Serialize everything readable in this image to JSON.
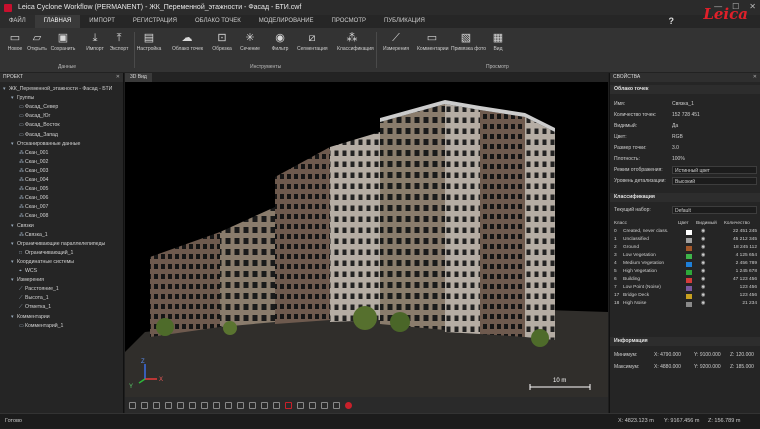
{
  "titlebar": {
    "title": "Leica Cyclone Workflow (PERMANENT) - ЖК_Переменной_этажности - Фасад - БТИ.cwf",
    "minimize": "—",
    "maximize": "☐",
    "close": "✕"
  },
  "menu": {
    "tabs": [
      "ФАЙЛ",
      "ГЛАВНАЯ",
      "ИМПОРТ",
      "РЕГИСТРАЦИЯ",
      "ОБЛАКО ТОЧЕК",
      "МОДЕЛИРОВАНИЕ",
      "ПРОСМОТР",
      "ПУБЛИКАЦИЯ"
    ],
    "help": "?",
    "brand": "Leica"
  },
  "ribbon": {
    "buttons": [
      "Новое",
      "Открыть",
      "Сохранить",
      "Импорт",
      "Экспорт",
      "Настройка",
      "Облако точек",
      "Обрезка",
      "Сечение",
      "Фильтр",
      "Сегментация",
      "Классификация",
      "Измерения",
      "Комментарии",
      "Привязка фото",
      "Вид"
    ],
    "groups": [
      "Данные",
      "Инструменты",
      "Просмотр"
    ]
  },
  "project": {
    "header": "ПРОЕКТ",
    "items": [
      {
        "label": "ЖК_Переменной_этажности - Фасад - БТИ"
      },
      {
        "label": "Группы"
      },
      {
        "label": "Фасад_Север"
      },
      {
        "label": "Фасад_Юг"
      },
      {
        "label": "Фасад_Восток"
      },
      {
        "label": "Фасад_Запад"
      },
      {
        "label": "Отсканированные данные"
      },
      {
        "label": "Скан_001"
      },
      {
        "label": "Скан_002"
      },
      {
        "label": "Скан_003"
      },
      {
        "label": "Скан_004"
      },
      {
        "label": "Скан_005"
      },
      {
        "label": "Скан_006"
      },
      {
        "label": "Скан_007"
      },
      {
        "label": "Скан_008"
      },
      {
        "label": "Связки"
      },
      {
        "label": "Связка_1"
      },
      {
        "label": "Ограничивающие параллелепипеды"
      },
      {
        "label": "Ограничивающий_1"
      },
      {
        "label": "Координатные системы"
      },
      {
        "label": "WCS"
      },
      {
        "label": "Измерения"
      },
      {
        "label": "Расстояние_1"
      },
      {
        "label": "Высота_1"
      },
      {
        "label": "Отметка_1"
      },
      {
        "label": "Комментарии"
      },
      {
        "label": "Комментарий_1"
      }
    ]
  },
  "viewport": {
    "tab": "3D Вид",
    "scale_label": "10 m",
    "axis_x": "X",
    "axis_y": "Y",
    "axis_z": "Z"
  },
  "properties": {
    "header": "СВОЙСТВА",
    "section_point_cloud": "Облако точек",
    "rows": [
      {
        "k": "Имя:",
        "v": "Связка_1"
      },
      {
        "k": "Количество точек:",
        "v": "152 728 451"
      },
      {
        "k": "Видимый:",
        "v": "Да"
      },
      {
        "k": "Цвет:",
        "v": "RGB"
      },
      {
        "k": "Размер точки:",
        "v": "3.0"
      },
      {
        "k": "Плотность:",
        "v": "100%"
      },
      {
        "k": "Режим отображения:",
        "v": "Истинный цвет"
      },
      {
        "k": "Уровень детализации:",
        "v": "Высокий"
      }
    ],
    "section_classification": "Классификация",
    "current_set_label": "Текущий набор:",
    "current_set": "Default",
    "cls_headers": [
      "Класс",
      "Цвет",
      "Видимый",
      "Количество"
    ],
    "classes": [
      {
        "id": "0",
        "name": "Created, never class.",
        "color": "#ffffff",
        "count": "22 451 245"
      },
      {
        "id": "1",
        "name": "Unclassified",
        "color": "#a0a0a0",
        "count": "45 212 345"
      },
      {
        "id": "2",
        "name": "Ground",
        "color": "#a5582a",
        "count": "18 245 112"
      },
      {
        "id": "3",
        "name": "Low Vegetation",
        "color": "#3fb44a",
        "count": "4 125 654"
      },
      {
        "id": "4",
        "name": "Medium Vegetation",
        "color": "#1e7fd8",
        "count": "2 456 789"
      },
      {
        "id": "5",
        "name": "High Vegetation",
        "color": "#2ea83a",
        "count": "1 245 678"
      },
      {
        "id": "6",
        "name": "Building",
        "color": "#d43c3c",
        "count": "47 123 456"
      },
      {
        "id": "7",
        "name": "Low Point (Noise)",
        "color": "#7a5aa0",
        "count": "123 456"
      },
      {
        "id": "17",
        "name": "Bridge Deck",
        "color": "#c8a020",
        "count": "123 456"
      },
      {
        "id": "18",
        "name": "High Noise",
        "color": "#8a8a8a",
        "count": "21 234"
      }
    ],
    "section_info": "Информация",
    "min_label": "Минимум:",
    "max_label": "Максимум:",
    "min": {
      "x": "X: 4790.000",
      "y": "Y: 9100.000",
      "z": "Z: 120.000"
    },
    "max": {
      "x": "X: 4880.000",
      "y": "Y: 9200.000",
      "z": "Z: 185.000"
    }
  },
  "status": {
    "left": "Готово",
    "x": "X: 4823.123 m",
    "y": "Y: 9167.456 m",
    "z": "Z: 156.789 m"
  }
}
